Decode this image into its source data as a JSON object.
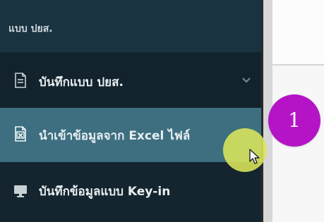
{
  "sidebar": {
    "header_label": "แบบ ปยส.",
    "items": [
      {
        "label": "บันทึกแบบ ปยส.",
        "icon": "document-icon"
      },
      {
        "label": "นำเข้าข้อมูลจาก Excel ไฟล์",
        "icon": "excel-file-icon"
      },
      {
        "label": "บันทึกข้อมูลแบบ Key-in",
        "icon": "monitor-icon"
      }
    ]
  },
  "annotation": {
    "step_number": "1"
  },
  "colors": {
    "sidebar_bg": "#13232d",
    "active_item_bg": "#3d6f80",
    "badge": "#b414c6",
    "highlight": "#dce65a"
  }
}
